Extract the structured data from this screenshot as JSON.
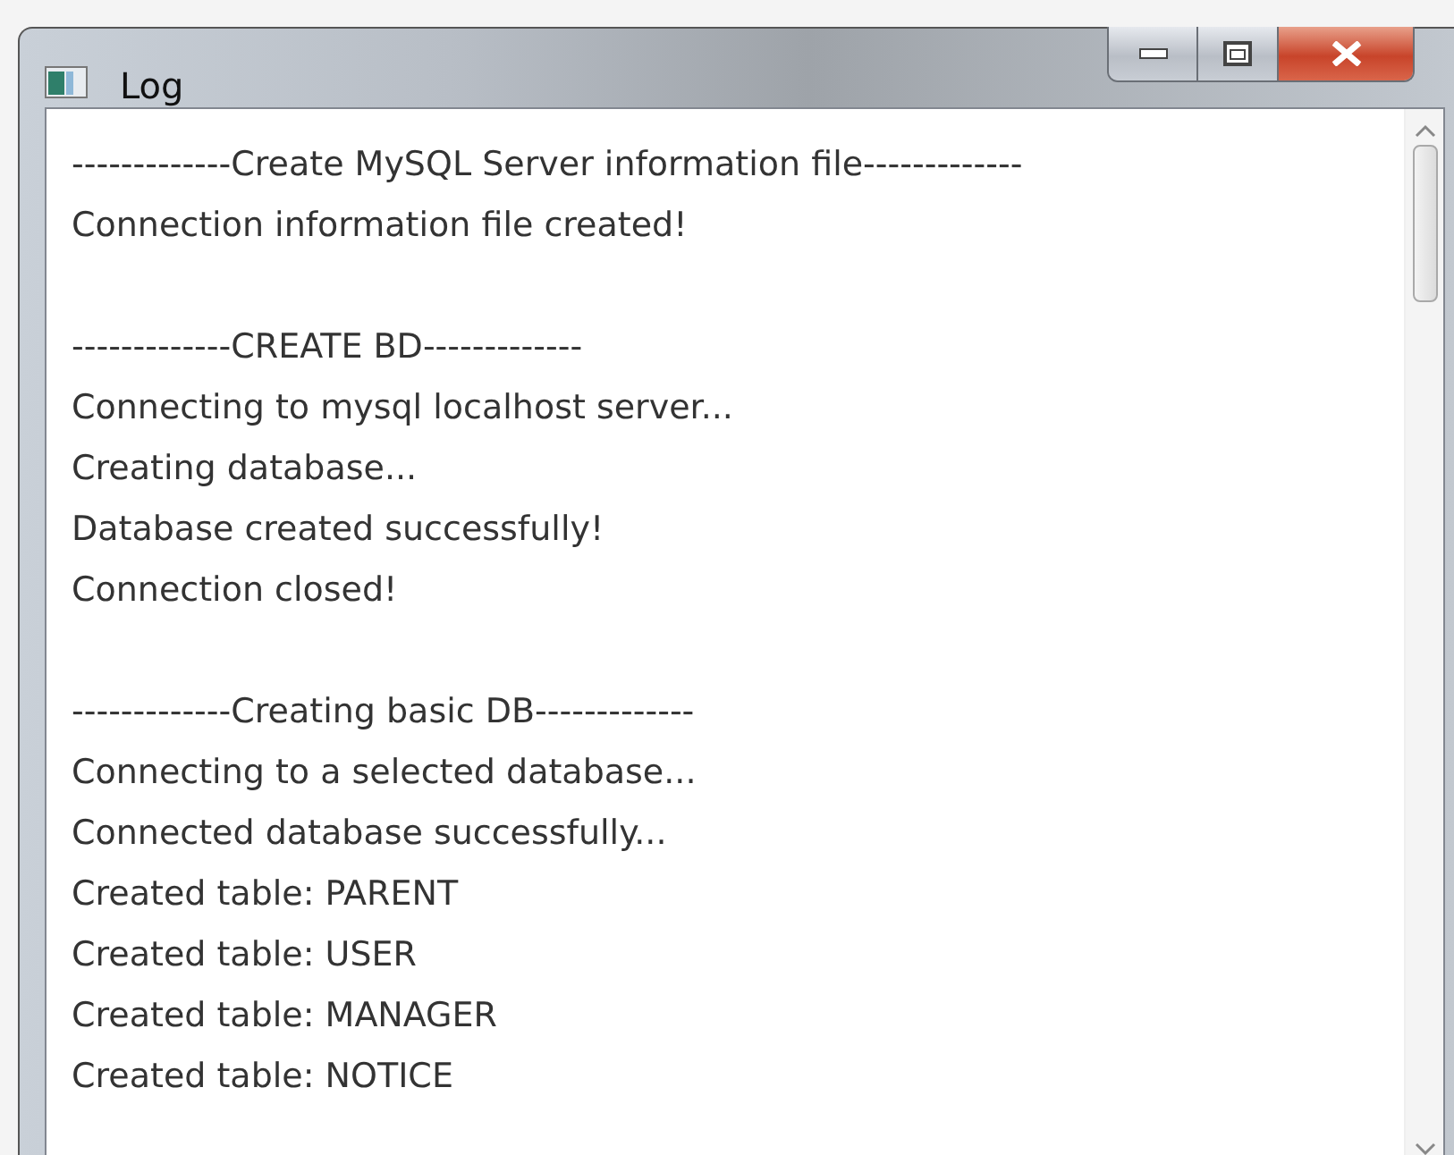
{
  "window": {
    "title": "Log"
  },
  "log_sections": [
    {
      "lines": [
        "-------------Create MySQL Server information file-------------",
        "Connection information file created!"
      ]
    },
    {
      "lines": [
        "-------------CREATE BD-------------",
        "Connecting to mysql localhost server...",
        "Creating database...",
        "Database created successfully!",
        "Connection closed!"
      ]
    },
    {
      "lines": [
        "-------------Creating basic DB-------------",
        "Connecting to a selected database...",
        "Connected database successfully...",
        "Created table: PARENT",
        "Created table: USER",
        "Created table: MANAGER",
        "Created table: NOTICE"
      ]
    }
  ]
}
